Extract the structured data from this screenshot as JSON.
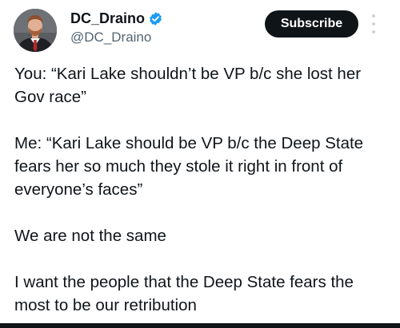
{
  "author": {
    "display_name": "DC_Draino",
    "handle": "@DC_Draino",
    "verified_color": "#1d9bf0"
  },
  "actions": {
    "subscribe_label": "Subscribe"
  },
  "tweet": {
    "paragraphs": [
      "You: “Kari Lake shouldn’t be VP b/c she lost her Gov race”",
      "Me: “Kari Lake should be VP b/c the Deep State fears her so much they stole it right in front of everyone’s faces”",
      "We are not the same",
      "I want the people that the Deep State fears the most to be our retribution"
    ]
  },
  "icons": {
    "avatar": "profile-photo",
    "verified": "verified-badge-icon",
    "more": "more-vertical-icon"
  }
}
